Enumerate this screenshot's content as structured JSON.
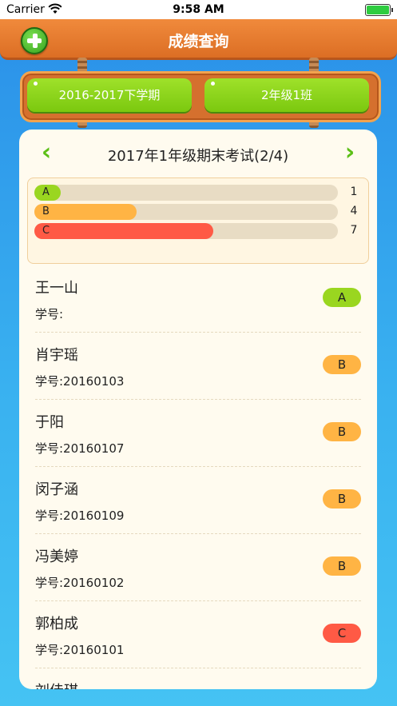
{
  "status_bar": {
    "carrier": "Carrier",
    "time": "9:58 AM"
  },
  "nav": {
    "title": "成绩查询",
    "back_icon": "plus-circle-icon"
  },
  "selectors": {
    "term": "2016-2017下学期",
    "class": "2年级1班"
  },
  "exam": {
    "title": "2017年1年级期末考试(2/4)"
  },
  "stats": [
    {
      "grade": "A",
      "count": "1",
      "fraction": 0.0857,
      "color": "#9ad620"
    },
    {
      "grade": "B",
      "count": "4",
      "fraction": 0.3368,
      "color": "#ffb444"
    },
    {
      "grade": "C",
      "count": "7",
      "fraction": 0.5894,
      "color": "#ff5a45"
    }
  ],
  "students": [
    {
      "name": "王一山",
      "id_label": "学号:",
      "grade": "A"
    },
    {
      "name": "肖宇瑶",
      "id_label": "学号:20160103",
      "grade": "B"
    },
    {
      "name": "于阳",
      "id_label": "学号:20160107",
      "grade": "B"
    },
    {
      "name": "闵子涵",
      "id_label": "学号:20160109",
      "grade": "B"
    },
    {
      "name": "冯美婷",
      "id_label": "学号:20160102",
      "grade": "B"
    },
    {
      "name": "郭柏成",
      "id_label": "学号:20160101",
      "grade": "C"
    },
    {
      "name": "刘佳琪",
      "id_label": "",
      "grade": ""
    }
  ]
}
